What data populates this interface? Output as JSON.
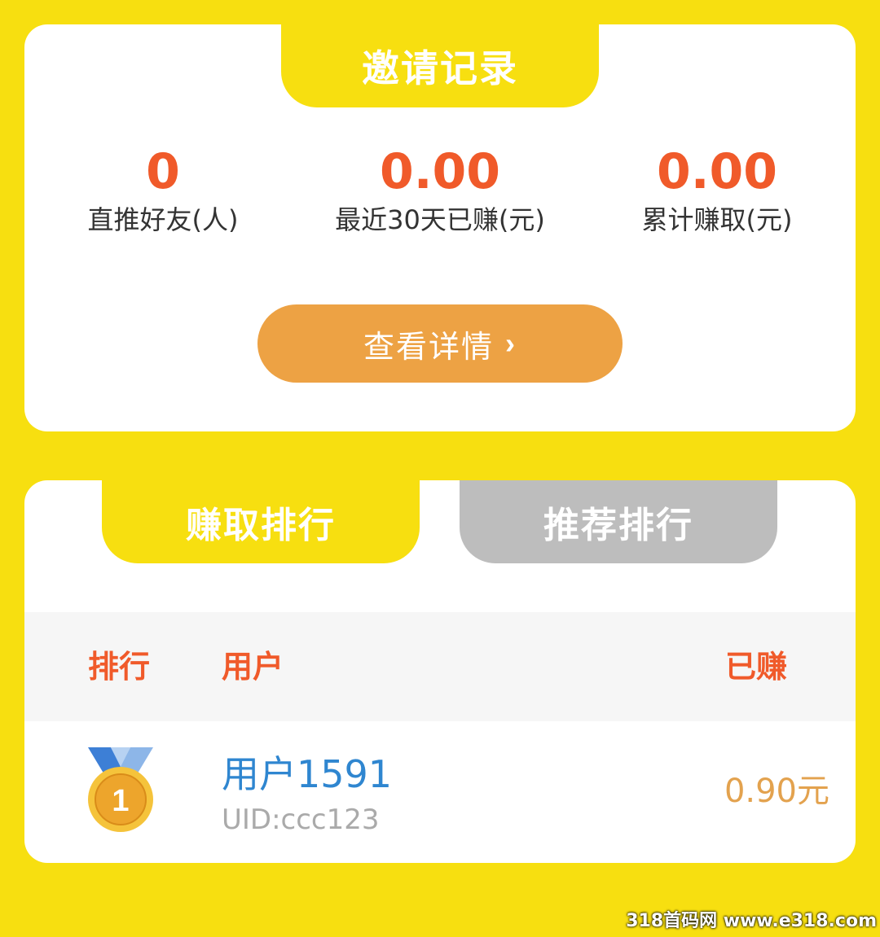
{
  "invite": {
    "title": "邀请记录",
    "stats": [
      {
        "value": "0",
        "label": "直推好友(人)"
      },
      {
        "value": "0.00",
        "label": "最近30天已赚(元)"
      },
      {
        "value": "0.00",
        "label": "累计赚取(元)"
      }
    ],
    "details_button": "查看详情",
    "details_icon": "chevron-right-icon"
  },
  "ranking": {
    "tabs": [
      {
        "label": "赚取排行",
        "active": true
      },
      {
        "label": "推荐排行",
        "active": false
      }
    ],
    "columns": {
      "rank": "排行",
      "user": "用户",
      "earned": "已赚"
    },
    "rows": [
      {
        "rank": "1",
        "rank_icon": "gold-medal-icon",
        "name": "用户1591",
        "uid": "UID:ccc123",
        "earned": "0.90元"
      }
    ]
  },
  "watermark": "318首码网 www.e318.com",
  "colors": {
    "background": "#f7df10",
    "accent_orange": "#f05a2a",
    "button": "#eda244",
    "inactive_tab": "#bdbdbd",
    "user_blue": "#2f86d0",
    "earned_gold": "#e3a24e"
  }
}
